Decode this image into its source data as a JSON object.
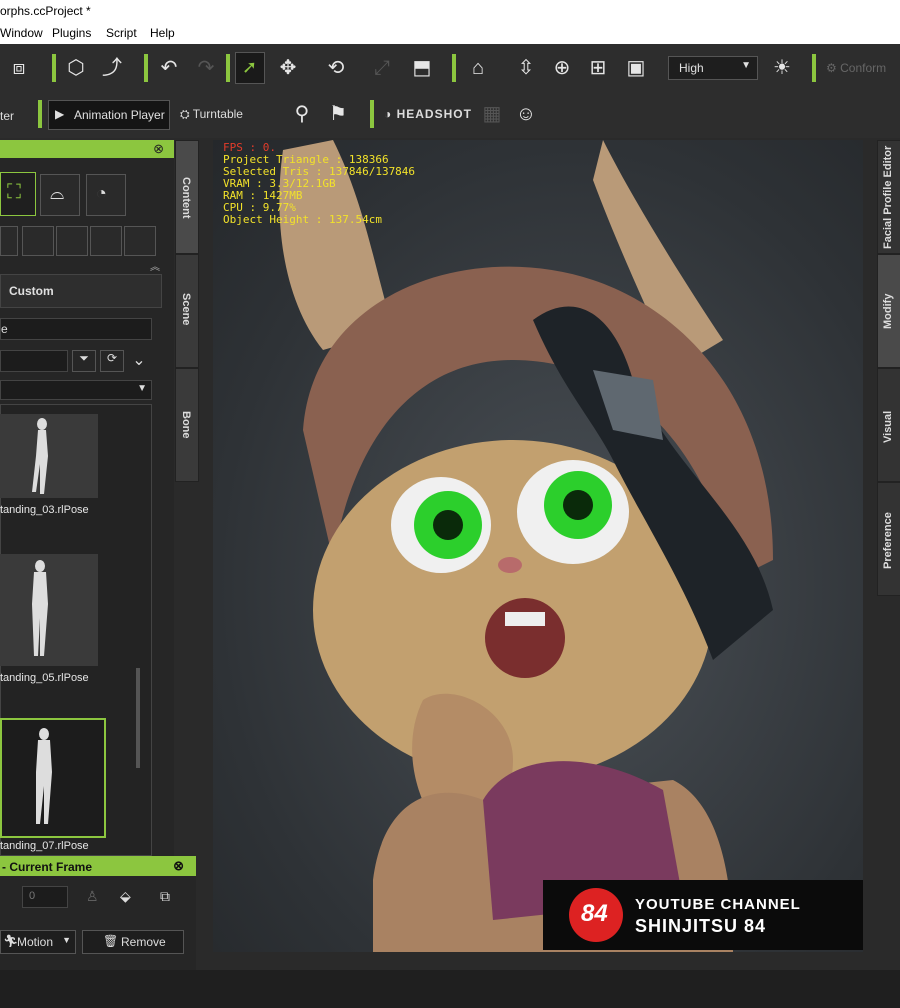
{
  "window": {
    "title": "orphs.ccProject *"
  },
  "menu": {
    "items": [
      "Window",
      "Plugins",
      "Script",
      "Help"
    ]
  },
  "toolbar": {
    "quality_select": "High",
    "conform_label": "Conform",
    "animation_player_label": "Animation Player",
    "turntable_label": "Turntable",
    "headshot_label": "HEADSHOT",
    "partial_left_label": "ter"
  },
  "left_panel": {
    "custom_label": "Custom",
    "search_fragment": "e",
    "files": [
      "tanding_03.rlPose",
      "tanding_05.rlPose",
      "tanding_07.rlPose"
    ],
    "tabs": [
      "Content",
      "Scene",
      "Bone"
    ]
  },
  "right_tabs": [
    "Facial Profile Editor",
    "Modify",
    "Visual",
    "Preference"
  ],
  "viewport": {
    "stats": [
      "FPS : 0.",
      "Project Triangle : 138366",
      "Selected Tris : 137846/137846",
      "VRAM : 3.3/12.1GB",
      "RAM : 1427MB",
      "CPU : 9.77%",
      "Object Height : 137.54cm"
    ],
    "watermark": {
      "line1": "YOUTUBE CHANNEL",
      "line2": "SHINJITSU 84",
      "logo_text": "84"
    }
  },
  "bottom_panel": {
    "title": "- Current Frame",
    "frame_value": "0",
    "motion_label": "Motion",
    "remove_label": "Remove"
  },
  "colors": {
    "accent": "#8cc63f",
    "stats": "#f2e22a",
    "eye": "#2ccf2c"
  }
}
